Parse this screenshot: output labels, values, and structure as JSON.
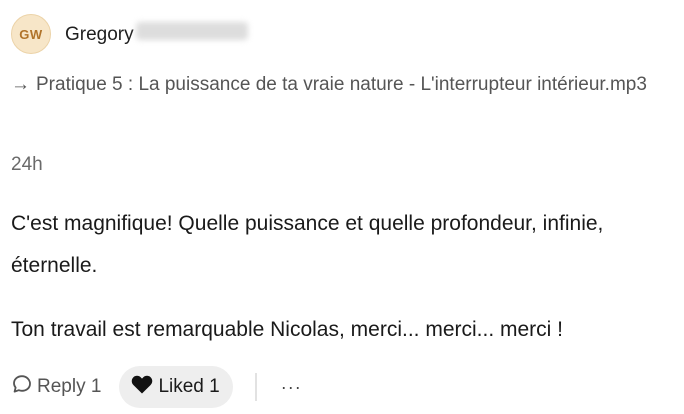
{
  "author": {
    "initials": "GW",
    "name": "Gregory"
  },
  "source": {
    "arrow": "→",
    "text": "Pratique 5 : La puissance de ta vraie nature - L'interrupteur intérieur.mp3"
  },
  "timestamp": "24h",
  "body": {
    "paragraph1": "C'est magnifique! Quelle puissance et quelle profondeur, infinie, éternelle.",
    "paragraph2": "Ton travail est remarquable Nicolas, merci... merci... merci !"
  },
  "actions": {
    "reply_label": "Reply",
    "reply_count": "1",
    "liked_label": "Liked",
    "like_count": "1",
    "more_label": "···"
  },
  "icons": {
    "reply": "speech-bubble-icon",
    "like": "heart-icon"
  },
  "colors": {
    "avatar_bg": "#f7e6c8",
    "avatar_text": "#b0742b",
    "liked_bg": "#eeeeee"
  }
}
